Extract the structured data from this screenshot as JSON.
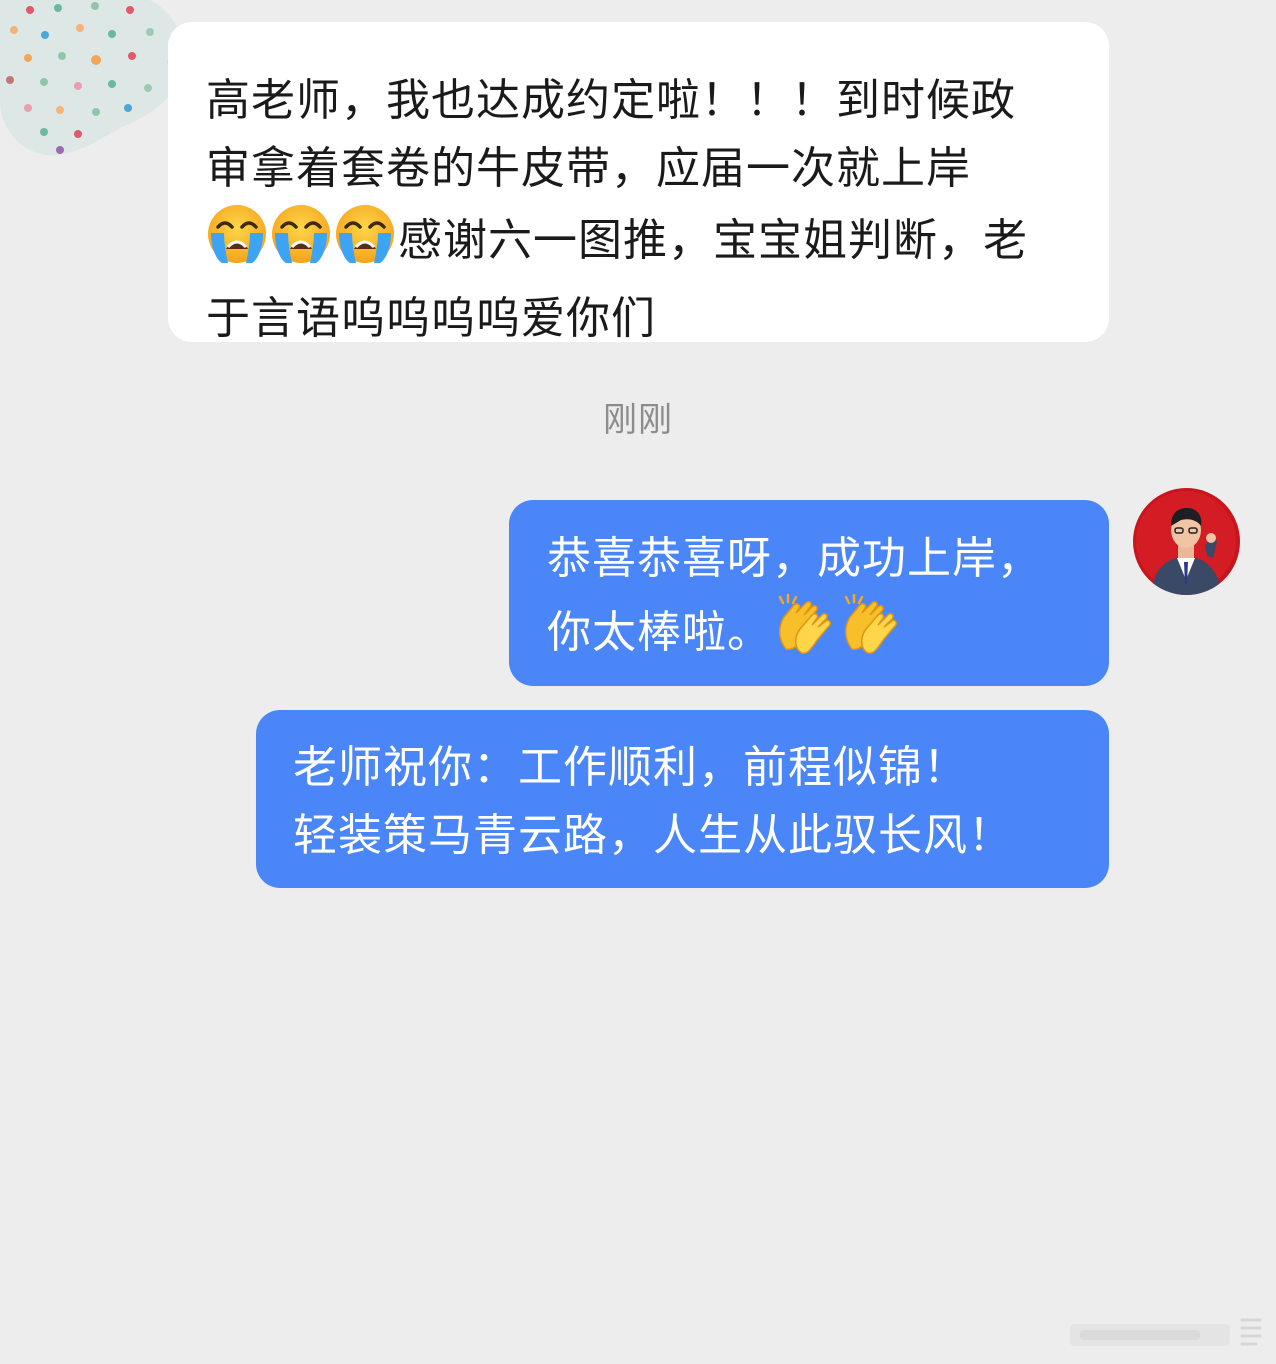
{
  "messages": {
    "received_1": {
      "line1": "高老师，我也达成约定啦！！！到时候政",
      "line2": "审拿着套卷的牛皮带，应届一次就上岸",
      "line3_emoji": "loudly-crying-face-icon",
      "line3_text": "感谢六一图推，宝宝姐判断，老",
      "line4": "于言语呜呜呜呜爱你们"
    },
    "timestamp": "刚刚",
    "sent_1": {
      "line1": "恭喜恭喜呀，成功上岸，",
      "line2": "你太棒啦。",
      "emoji": "clapping-hands-icon"
    },
    "sent_2": {
      "line1": "老师祝你：工作顺利，前程似锦！",
      "line2": "轻装策马青云路，人生从此驭长风！"
    }
  },
  "colors": {
    "background": "#ededed",
    "received_bubble": "#ffffff",
    "sent_bubble": "#4a86f7",
    "timestamp": "#8c8c8c"
  }
}
